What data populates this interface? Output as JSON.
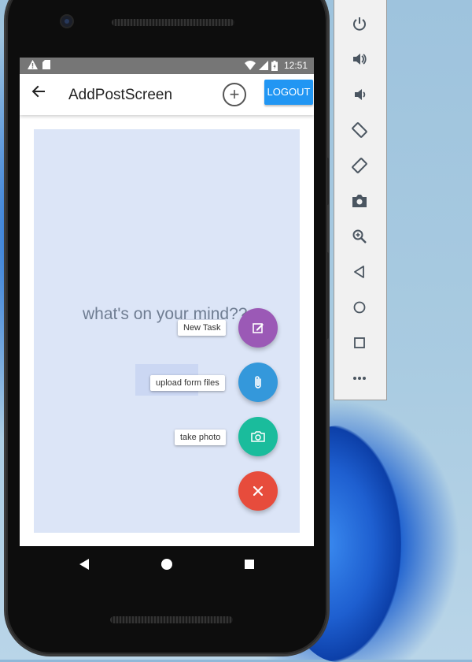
{
  "status_bar": {
    "time": "12:51"
  },
  "app_bar": {
    "title": "AddPostScreen",
    "logout_label": "LOGOUT"
  },
  "post": {
    "placeholder": "what's on your mind??"
  },
  "fab_menu": {
    "items": [
      {
        "label": "New Task",
        "icon": "edit-icon",
        "color": "#9b59b6"
      },
      {
        "label": "upload form files",
        "icon": "paperclip-icon",
        "color": "#3498db"
      },
      {
        "label": "take photo",
        "icon": "camera-icon",
        "color": "#1abc9c"
      }
    ],
    "close": {
      "icon": "close-icon",
      "color": "#e74c3c"
    }
  },
  "emulator_panel": {
    "buttons": [
      "power-icon",
      "volume-up-icon",
      "volume-down-icon",
      "rotate-left-icon",
      "rotate-right-icon",
      "screenshot-camera-icon",
      "zoom-icon",
      "back-icon",
      "home-icon",
      "overview-icon",
      "more-icon"
    ]
  },
  "colors": {
    "accent": "#2196f3",
    "post_area": "#dce5f7"
  }
}
